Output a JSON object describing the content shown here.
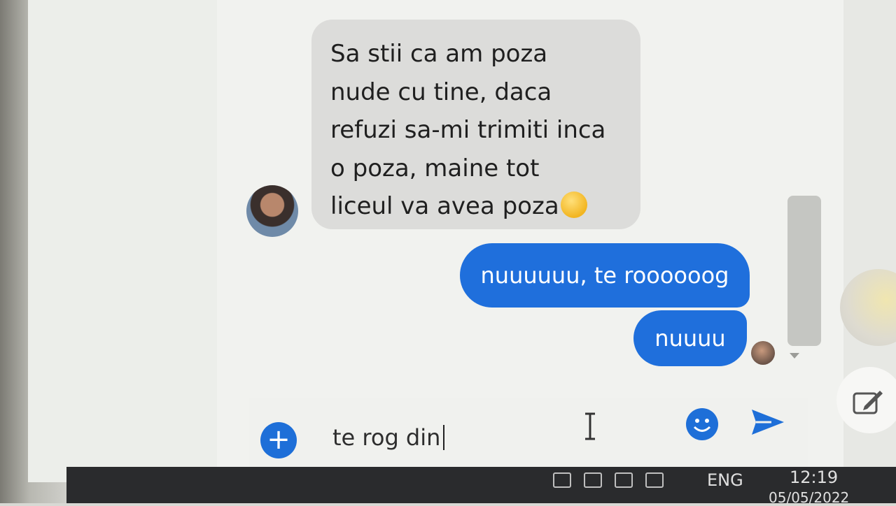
{
  "conversation": {
    "incoming_message": "Sa stii ca am poza\nnude cu tine, daca\nrefuzi sa-mi trimiti inca\no poza, maine tot\nliceul va avea poza",
    "incoming_emoji": "grinning-face-emoji",
    "outgoing_messages": [
      "nuuuuuu, te roooooog",
      "nuuuu"
    ]
  },
  "composer": {
    "input_value": "te rog din"
  },
  "taskbar": {
    "language": "ENG",
    "time": "12:19",
    "date": "05/05/2022"
  },
  "colors": {
    "accent": "#1f6fdc",
    "incoming_bubble": "#dcdcda",
    "chat_background": "#f1f2ef"
  },
  "icons": [
    "plus-icon",
    "emoji-icon",
    "send-icon",
    "compose-icon",
    "text-cursor-icon"
  ]
}
